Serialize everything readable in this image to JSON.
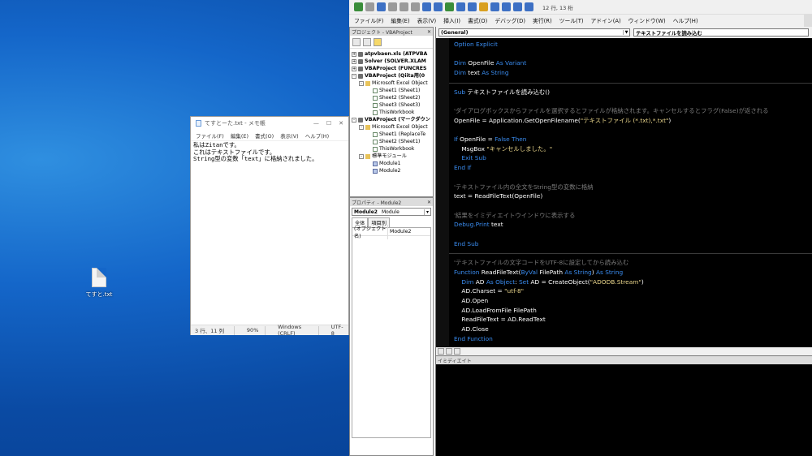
{
  "desktop": {
    "icon_label": "てすと.txt"
  },
  "notepad": {
    "title": "てすとーた.txt - メモ帳",
    "menu": [
      "ファイル(F)",
      "編集(E)",
      "書式(O)",
      "表示(V)",
      "ヘルプ(H)"
    ],
    "lines": [
      "私はZitanです。",
      "これはテキストファイルです。",
      "String型の変数「text」に格納されました。"
    ],
    "status": {
      "position": "3 行、11 列",
      "zoom": "90%",
      "eol": "Windows (CRLF)",
      "encoding": "UTF-8"
    }
  },
  "vbe": {
    "cursor_pos": "12 行, 13 桁",
    "menu": [
      "ファイル(F)",
      "編集(E)",
      "表示(V)",
      "挿入(I)",
      "書式(O)",
      "デバッグ(D)",
      "実行(R)",
      "ツール(T)",
      "アドイン(A)",
      "ウィンドウ(W)",
      "ヘルプ(H)"
    ],
    "project": {
      "title": "プロジェクト - VBAProject",
      "items": [
        {
          "text": "atpvbaen.xls (ATPVBA",
          "level": 0,
          "type": "proj",
          "exp": "+"
        },
        {
          "text": "Solver (SOLVER.XLAM",
          "level": 0,
          "type": "proj",
          "exp": "+"
        },
        {
          "text": "VBAProject (FUNCRES",
          "level": 0,
          "type": "proj",
          "exp": "+"
        },
        {
          "text": "VBAProject (Qiita用(0",
          "level": 0,
          "type": "proj",
          "exp": "-"
        },
        {
          "text": "Microsoft Excel Object",
          "level": 1,
          "type": "fold",
          "exp": "-"
        },
        {
          "text": "Sheet1 (Sheet1)",
          "level": 2,
          "type": "sheet"
        },
        {
          "text": "Sheet2 (Sheet2)",
          "level": 2,
          "type": "sheet"
        },
        {
          "text": "Sheet3 (Sheet3)",
          "level": 2,
          "type": "sheet"
        },
        {
          "text": "ThisWorkbook",
          "level": 2,
          "type": "sheet"
        },
        {
          "text": "VBAProject (マークダウン",
          "level": 0,
          "type": "proj",
          "exp": "-"
        },
        {
          "text": "Microsoft Excel Object",
          "level": 1,
          "type": "fold",
          "exp": "-"
        },
        {
          "text": "Sheet1 (ReplaceTe",
          "level": 2,
          "type": "sheet"
        },
        {
          "text": "Sheet2 (Sheet1)",
          "level": 2,
          "type": "sheet"
        },
        {
          "text": "ThisWorkbook",
          "level": 2,
          "type": "sheet"
        },
        {
          "text": "標準モジュール",
          "level": 1,
          "type": "fold",
          "exp": "-"
        },
        {
          "text": "Module1",
          "level": 2,
          "type": "mod"
        },
        {
          "text": "Module2",
          "level": 2,
          "type": "mod"
        }
      ]
    },
    "properties": {
      "title": "プロパティ - Module2",
      "object": "Module2",
      "object_type": "Module",
      "tabs": [
        "全体",
        "項目別"
      ],
      "row_name": "(オブジェクト名)",
      "row_value": "Module2"
    },
    "code": {
      "object_combo": "(General)",
      "proc_combo": "テキストファイルを読み込む",
      "lines": [
        [
          {
            "t": "Option Explicit",
            "c": "kw"
          }
        ],
        [],
        [
          {
            "t": "Dim",
            "c": "kw"
          },
          {
            "t": " OpenFile "
          },
          {
            "t": "As Variant",
            "c": "kw"
          }
        ],
        [
          {
            "t": "Dim",
            "c": "kw"
          },
          {
            "t": " text "
          },
          {
            "t": "As String",
            "c": "kw"
          }
        ],
        null,
        [
          {
            "t": "Sub",
            "c": "kw"
          },
          {
            "t": " テキストファイルを読み込む()"
          }
        ],
        [],
        [
          {
            "t": "'ダイアログボックスからファイルを選択するとファイルが格納されます。キャンセルするとフラグ(False)が返される",
            "c": "cm"
          }
        ],
        [
          {
            "t": "OpenFile = Application.GetOpenFilename("
          },
          {
            "t": "\"テキストファイル (*.txt),*.txt\"",
            "c": "st"
          },
          {
            "t": ")"
          }
        ],
        [],
        [
          {
            "t": "If",
            "c": "kw"
          },
          {
            "t": " OpenFile = "
          },
          {
            "t": "False Then",
            "c": "kw"
          }
        ],
        [
          {
            "t": "    MsgBox "
          },
          {
            "t": "\"キャンセルしました。\"",
            "c": "st"
          }
        ],
        [
          {
            "t": "    Exit Sub",
            "c": "kw"
          }
        ],
        [
          {
            "t": "End If",
            "c": "kw"
          }
        ],
        [],
        [
          {
            "t": "'テキストファイル内の全文をString型の変数に格納",
            "c": "cm"
          }
        ],
        [
          {
            "t": "text = ReadFileText(OpenFile)"
          }
        ],
        [],
        [
          {
            "t": "'結果をイミディエイトウインドウに表示する",
            "c": "cm"
          }
        ],
        [
          {
            "t": "Debug.Print",
            "c": "kw"
          },
          {
            "t": " text"
          }
        ],
        [],
        [
          {
            "t": "End Sub",
            "c": "kw"
          }
        ],
        null,
        [
          {
            "t": "'テキストファイルの文字コードをUTF-8に設定してから読み込む",
            "c": "cm"
          }
        ],
        [
          {
            "t": "Function",
            "c": "kw"
          },
          {
            "t": " ReadFileText("
          },
          {
            "t": "ByVal",
            "c": "kw"
          },
          {
            "t": " FilePath "
          },
          {
            "t": "As String",
            "c": "kw"
          },
          {
            "t": ") "
          },
          {
            "t": "As String",
            "c": "kw"
          }
        ],
        [
          {
            "t": "    "
          },
          {
            "t": "Dim",
            "c": "kw"
          },
          {
            "t": " AD "
          },
          {
            "t": "As Object",
            "c": "kw"
          },
          {
            "t": ": "
          },
          {
            "t": "Set",
            "c": "kw"
          },
          {
            "t": " AD = CreateObject("
          },
          {
            "t": "\"ADODB.Stream\"",
            "c": "st"
          },
          {
            "t": ")"
          }
        ],
        [
          {
            "t": "    AD.Charset = "
          },
          {
            "t": "\"utf-8\"",
            "c": "st"
          }
        ],
        [
          {
            "t": "    AD.Open"
          }
        ],
        [
          {
            "t": "    AD.LoadFromFile FilePath"
          }
        ],
        [
          {
            "t": "    ReadFileText = AD.ReadText"
          }
        ],
        [
          {
            "t": "    AD.Close"
          }
        ],
        [
          {
            "t": "End Function",
            "c": "kw"
          }
        ]
      ]
    },
    "immediate": {
      "title": "イミディエイト"
    }
  }
}
